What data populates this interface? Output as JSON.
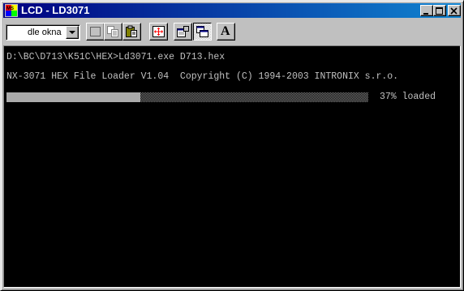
{
  "window": {
    "title": "LCD - LD3071",
    "controls": {
      "minimize_icon": "minimize-icon",
      "maximize_icon": "maximize-icon",
      "close_icon": "close-icon"
    }
  },
  "toolbar": {
    "font_size_select": {
      "value": "dle okna"
    },
    "buttons": [
      {
        "name": "mark-button",
        "icon": "dotted-rectangle-icon"
      },
      {
        "name": "copy-button",
        "icon": "copy-icon"
      },
      {
        "name": "paste-button",
        "icon": "paste-icon"
      },
      {
        "name": "fullscreen-button",
        "icon": "fullscreen-icon"
      },
      {
        "name": "properties-button",
        "icon": "properties-icon"
      },
      {
        "name": "background-button",
        "icon": "background-icon",
        "pressed": true
      },
      {
        "name": "font-button",
        "icon": "font-A-icon",
        "label": "A"
      }
    ]
  },
  "console": {
    "lines": [
      "D:\\BC\\D713\\K51C\\HEX>Ld3071.exe D713.hex",
      "NX-3071 HEX File Loader V1.04  Copyright (C) 1994-2003 INTRONIX s.r.o."
    ],
    "progress": {
      "percent": 37,
      "status_text": "37% loaded"
    }
  },
  "colors": {
    "titlebar_start": "#000080",
    "titlebar_end": "#1084d0",
    "console_bg": "#000000",
    "console_text": "#c0c0c0",
    "progress_fill": "#aaaaaa"
  }
}
